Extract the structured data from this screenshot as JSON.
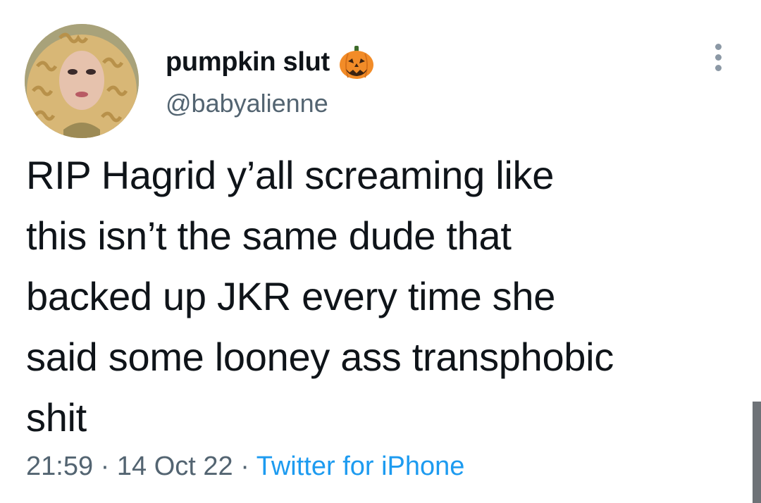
{
  "user": {
    "display_name": "pumpkin slut",
    "name_emoji": "jack-o-lantern-icon",
    "handle": "@babyalienne"
  },
  "tweet": {
    "lines": [
      "RIP Hagrid y’all screaming like",
      "this isn’t the same dude that",
      "backed up JKR every time she",
      "said some looney ass transphobic",
      "shit"
    ],
    "time": "21:59",
    "separator": "·",
    "date": "14 Oct 22",
    "source": "Twitter for iPhone"
  },
  "colors": {
    "text": "#0f1419",
    "secondary": "#536471",
    "link": "#1d9bf0",
    "pumpkin": "#f28c28"
  }
}
